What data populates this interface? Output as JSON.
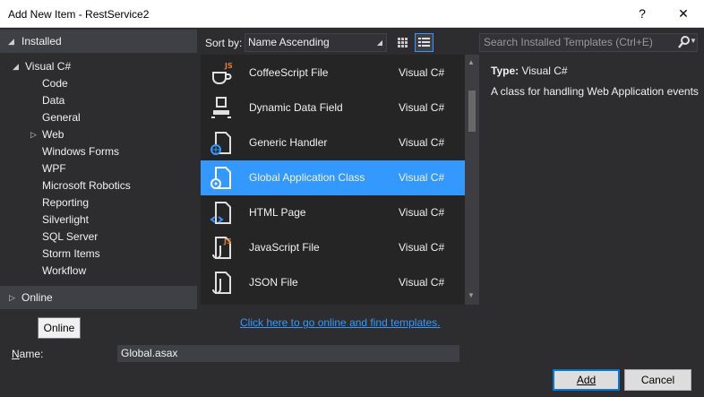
{
  "window": {
    "title": "Add New Item - RestService2",
    "help": "?",
    "close": "✕"
  },
  "tree": {
    "installed": "Installed",
    "visual_csharp": "Visual C#",
    "items": [
      "Code",
      "Data",
      "General",
      "Web",
      "Windows Forms",
      "WPF",
      "Microsoft Robotics",
      "Reporting",
      "Silverlight",
      "SQL Server",
      "Storm Items",
      "Workflow"
    ],
    "online": "Online"
  },
  "sort": {
    "label": "Sort by:",
    "value": "Name Ascending"
  },
  "search": {
    "placeholder": "Search Installed Templates (Ctrl+E)"
  },
  "templates": [
    {
      "name": "CoffeeScript File",
      "lang": "Visual C#",
      "icon": "coffeescript-file-icon"
    },
    {
      "name": "Dynamic Data Field",
      "lang": "Visual C#",
      "icon": "dynamic-data-field-icon"
    },
    {
      "name": "Generic Handler",
      "lang": "Visual C#",
      "icon": "generic-handler-icon"
    },
    {
      "name": "Global Application Class",
      "lang": "Visual C#",
      "icon": "global-application-class-icon",
      "selected": true
    },
    {
      "name": "HTML Page",
      "lang": "Visual C#",
      "icon": "html-page-icon"
    },
    {
      "name": "JavaScript File",
      "lang": "Visual C#",
      "icon": "javascript-file-icon"
    },
    {
      "name": "JSON File",
      "lang": "Visual C#",
      "icon": "json-file-icon"
    }
  ],
  "details": {
    "type_label": "Type:",
    "type_value": "Visual C#",
    "description": "A class for handling Web Application events"
  },
  "online_tooltip": "Online",
  "online_link": "Click here to go online and find templates.",
  "name_field": {
    "label_prefix": "N",
    "label_rest": "ame:",
    "value": "Global.asax"
  },
  "buttons": {
    "add": "Add",
    "cancel": "Cancel"
  },
  "colors": {
    "background": "#2d2d30",
    "accent": "#3399ff",
    "list": "#252526"
  }
}
